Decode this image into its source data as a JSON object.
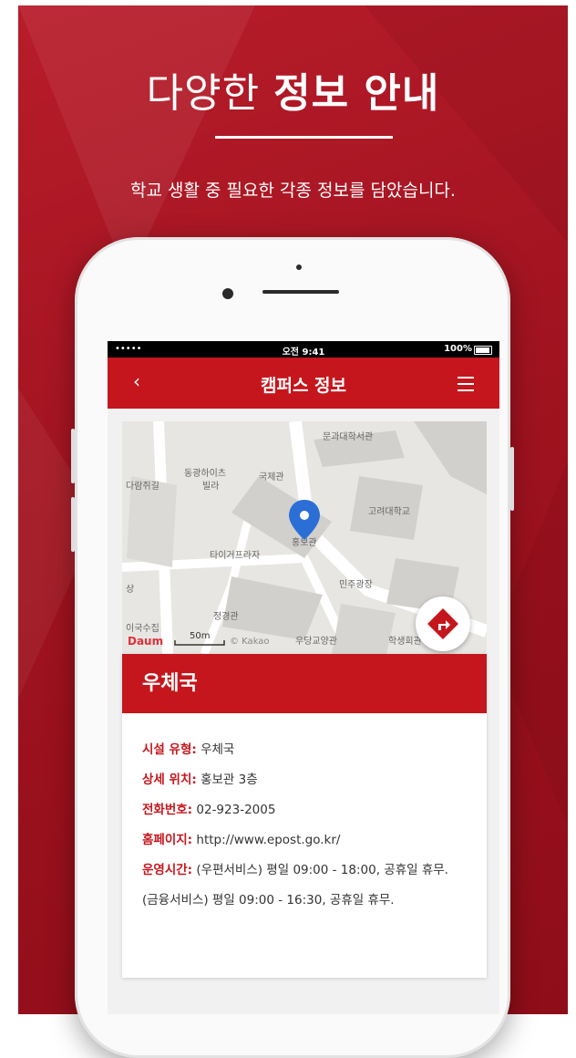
{
  "promo": {
    "headline_light": "다양한",
    "headline_bold": "정보 안내",
    "subline": "학교 생활 중 필요한 각종 정보를 담았습니다."
  },
  "status_bar": {
    "signal": "•••••",
    "time": "오전 9:41",
    "battery": "100%"
  },
  "nav": {
    "back_icon": "chevron-left-icon",
    "title": "캠퍼스 정보",
    "menu_icon": "hamburger-menu-icon"
  },
  "map": {
    "labels": {
      "l1": "문과대학서관",
      "l2": "동광하이츠",
      "l3": "빌라",
      "l4": "국제관",
      "l5": "홍보관",
      "l6": "타이거프라자",
      "l7": "민주광장",
      "l8": "정경관",
      "l9": "우당교양관",
      "l10": "학생회관",
      "l11": "고려대학교",
      "l12": "이국수집",
      "l13": "다람쥐길",
      "l14": "상"
    },
    "scale": "50m",
    "provider": "Daum",
    "copyright": "© Kakao",
    "directions_icon": "directions-arrow-icon",
    "pin_icon": "location-pin-icon"
  },
  "facility": {
    "name": "우체국",
    "rows": [
      {
        "key": "시설 유형:",
        "value": " 우체국"
      },
      {
        "key": "상세 위치:",
        "value": " 홍보관 3층"
      },
      {
        "key": "전화번호:",
        "value": " 02-923-2005"
      },
      {
        "key": "홈페이지:",
        "value": " http://www.epost.go.kr/"
      },
      {
        "key": "운영시간:",
        "value": " (우편서비스) 평일 09:00 - 18:00, 공휴일 휴무. (금융서비스) 평일 09:00 - 16:30, 공휴일 휴무."
      }
    ]
  },
  "colors": {
    "brand_red": "#c5161d",
    "promo_red": "#a0131f"
  }
}
